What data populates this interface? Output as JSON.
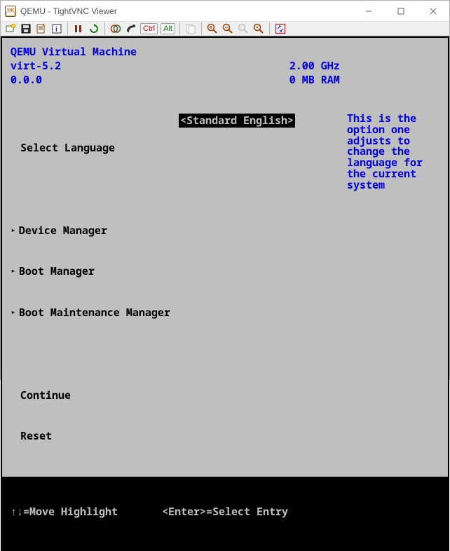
{
  "window": {
    "title": "QEMU - TightVNC Viewer"
  },
  "toolbar": {
    "ctrl_label": "Ctrl",
    "alt_label": "Alt"
  },
  "bios": {
    "header": {
      "line1_left": "QEMU Virtual Machine",
      "line2_left": "virt-5.2",
      "line2_right": "2.00 GHz",
      "line3_left": "0.0.0",
      "line3_right": "0 MB RAM"
    },
    "menu": {
      "select_language_label": "Select Language",
      "select_language_value": "<Standard English>",
      "device_manager": "Device Manager",
      "boot_manager": "Boot Manager",
      "boot_maint_manager": "Boot Maintenance Manager",
      "continue": "Continue",
      "reset": "Reset"
    },
    "help_text": "This is the option one adjusts to change the language for the current system",
    "footer": {
      "move": "↑↓=Move Highlight",
      "enter": "<Enter>=Select Entry"
    }
  }
}
